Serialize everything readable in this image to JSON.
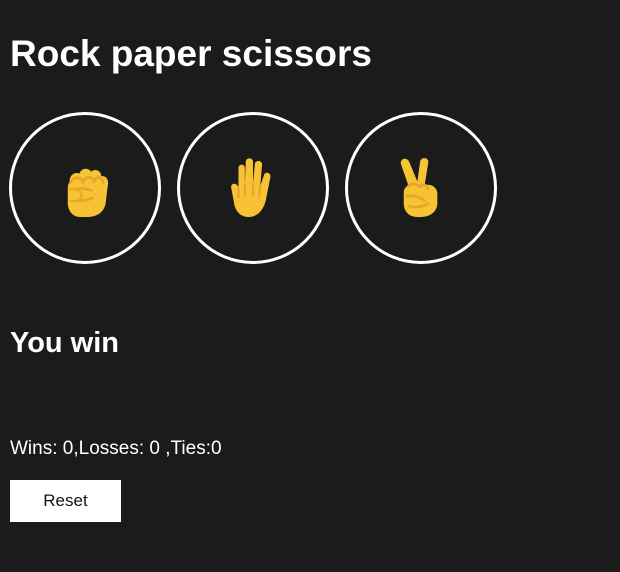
{
  "page": {
    "title": "Rock paper scissors"
  },
  "choices": [
    {
      "name": "rock",
      "icon": "raised-fist-icon",
      "glyph": "✊"
    },
    {
      "name": "paper",
      "icon": "raised-hand-icon",
      "glyph": "🖐"
    },
    {
      "name": "scissors",
      "icon": "victory-hand-icon",
      "glyph": "✌"
    }
  ],
  "result": {
    "text": "You win"
  },
  "score": {
    "text": "Wins: 0,Losses: 0 ,Ties:0"
  },
  "controls": {
    "reset_label": "Reset"
  },
  "colors": {
    "background": "#1b1b1b",
    "foreground": "#ffffff",
    "emoji_skin": "#f7c335",
    "emoji_shade": "#e7a52b"
  }
}
